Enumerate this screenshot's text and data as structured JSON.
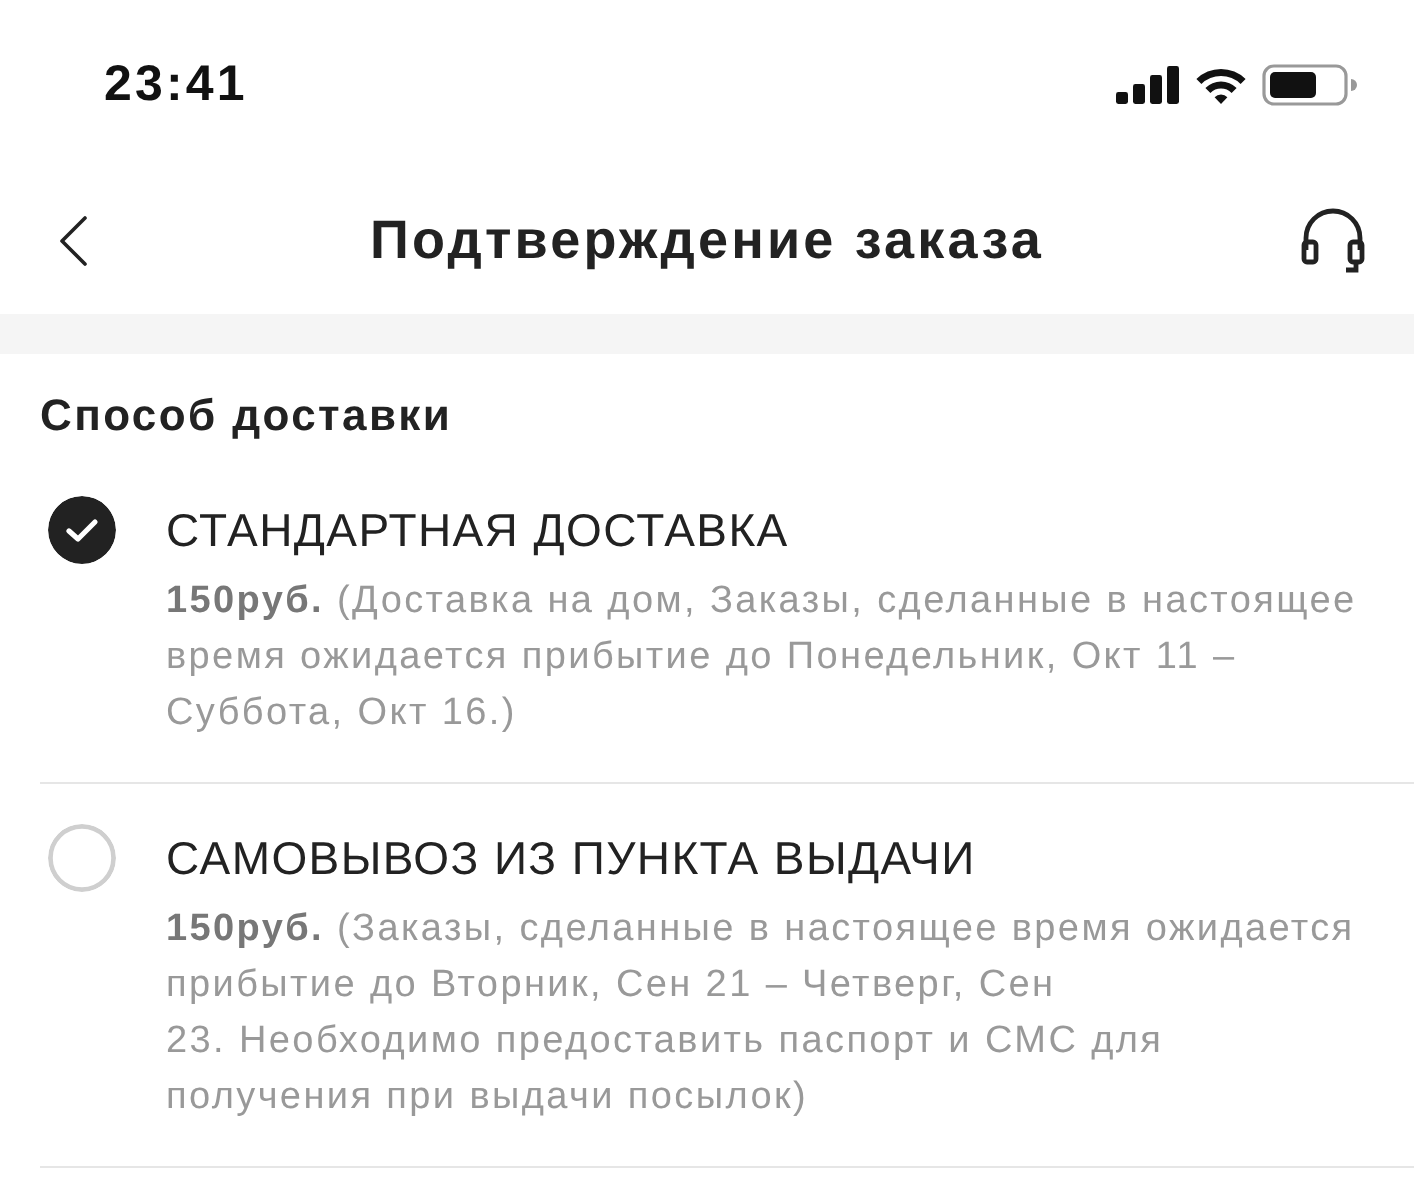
{
  "status_bar": {
    "time": "23:41"
  },
  "nav_bar": {
    "title": "Подтверждение заказа"
  },
  "delivery": {
    "title": "Способ доставки",
    "options": [
      {
        "title": "СТАНДАРТНАЯ ДОСТАВКА",
        "description": "**150руб.** (Доставка на дом, Заказы, сделанные в настоящее время ожидается прибытие до Понедельник, Окт 11 – Суббота, Окт 16.)",
        "selected": true
      },
      {
        "title": "САМОВЫВОЗ ИЗ ПУНКТА ВЫДАЧИ",
        "description": "**150руб.** (Заказы, сделанные в настоящее время ожидается прибытие до Вторник, Сен 21 – Четверг, Сен 23. Необходимо предоставить паспорт и СМС для получения при выдачи посылок)",
        "selected": false
      }
    ]
  }
}
